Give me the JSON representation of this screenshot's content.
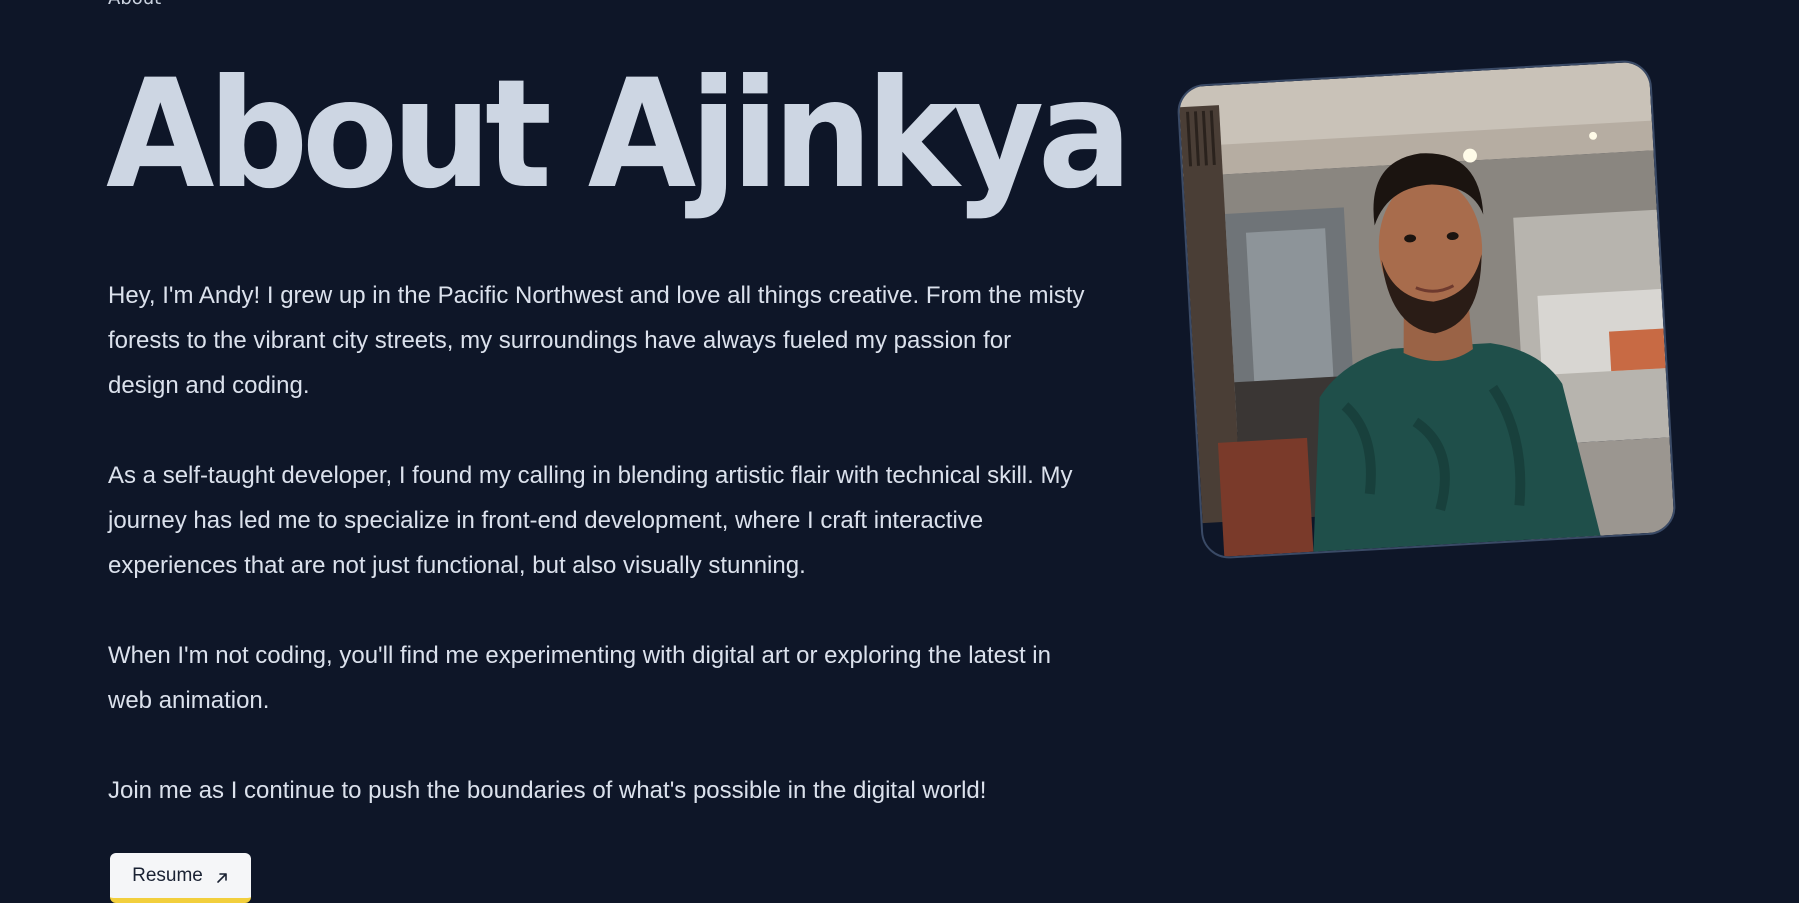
{
  "nav": {
    "current_label": "About"
  },
  "hero": {
    "title": "About Ajinkya"
  },
  "bio": {
    "paragraphs": [
      "Hey, I'm Andy! I grew up in the Pacific Northwest and love all things creative. From the misty forests to the vibrant city streets, my surroundings have always fueled my passion for design and coding.",
      "As a self-taught developer, I found my calling in blending artistic flair with technical skill. My journey has led me to specialize in front-end development, where I craft interactive experiences that are not just functional, but also visually stunning.",
      "When I'm not coding, you'll find me experimenting with digital art or exploring the latest in web animation.",
      "Join me as I continue to push the boundaries of what's possible in the digital world!"
    ]
  },
  "actions": {
    "resume_label": "Resume",
    "resume_icon": "arrow-up-right-icon"
  },
  "colors": {
    "background": "#0e1628",
    "title": "#cdd6e3",
    "text": "#dbe1ec",
    "button_bg": "#f5f6f8",
    "button_accent": "#f2cf3d"
  }
}
